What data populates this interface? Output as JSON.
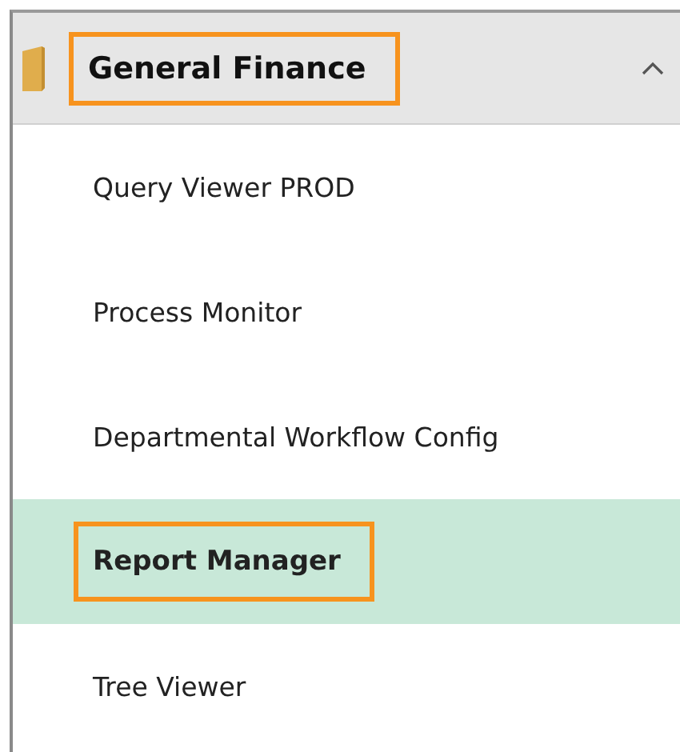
{
  "group": {
    "title": "General Finance",
    "expanded": true,
    "highlighted": true
  },
  "items": [
    {
      "label": "Query Viewer PROD",
      "selected": false,
      "highlighted": false
    },
    {
      "label": "Process Monitor",
      "selected": false,
      "highlighted": false
    },
    {
      "label": "Departmental Workflow Config",
      "selected": false,
      "highlighted": false
    },
    {
      "label": "Report Manager",
      "selected": true,
      "highlighted": true
    },
    {
      "label": "Tree Viewer",
      "selected": false,
      "highlighted": false
    }
  ]
}
